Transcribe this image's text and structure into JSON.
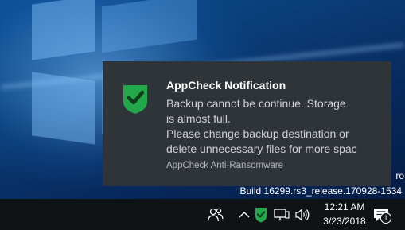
{
  "desktop": {
    "watermark_line1": "ro",
    "watermark_line2": "Build 16299.rs3_release.170928-1534"
  },
  "toast": {
    "title": "AppCheck Notification",
    "body_lines": [
      "Backup cannot be continue. Storage",
      "is almost full.",
      "Please change backup destination or",
      "delete unnecessary files for more spac"
    ],
    "attribution": "AppCheck Anti-Ransomware",
    "logo_icon": "appcheck-shield-icon",
    "brand_color": "#22a84a"
  },
  "taskbar": {
    "time": "12:21 AM",
    "date": "3/23/2018",
    "notification_count": "1",
    "tray_icons": [
      "people-icon",
      "chevron-up-icon",
      "appcheck-shield-icon",
      "network-icon",
      "volume-icon",
      "action-center-icon"
    ]
  }
}
